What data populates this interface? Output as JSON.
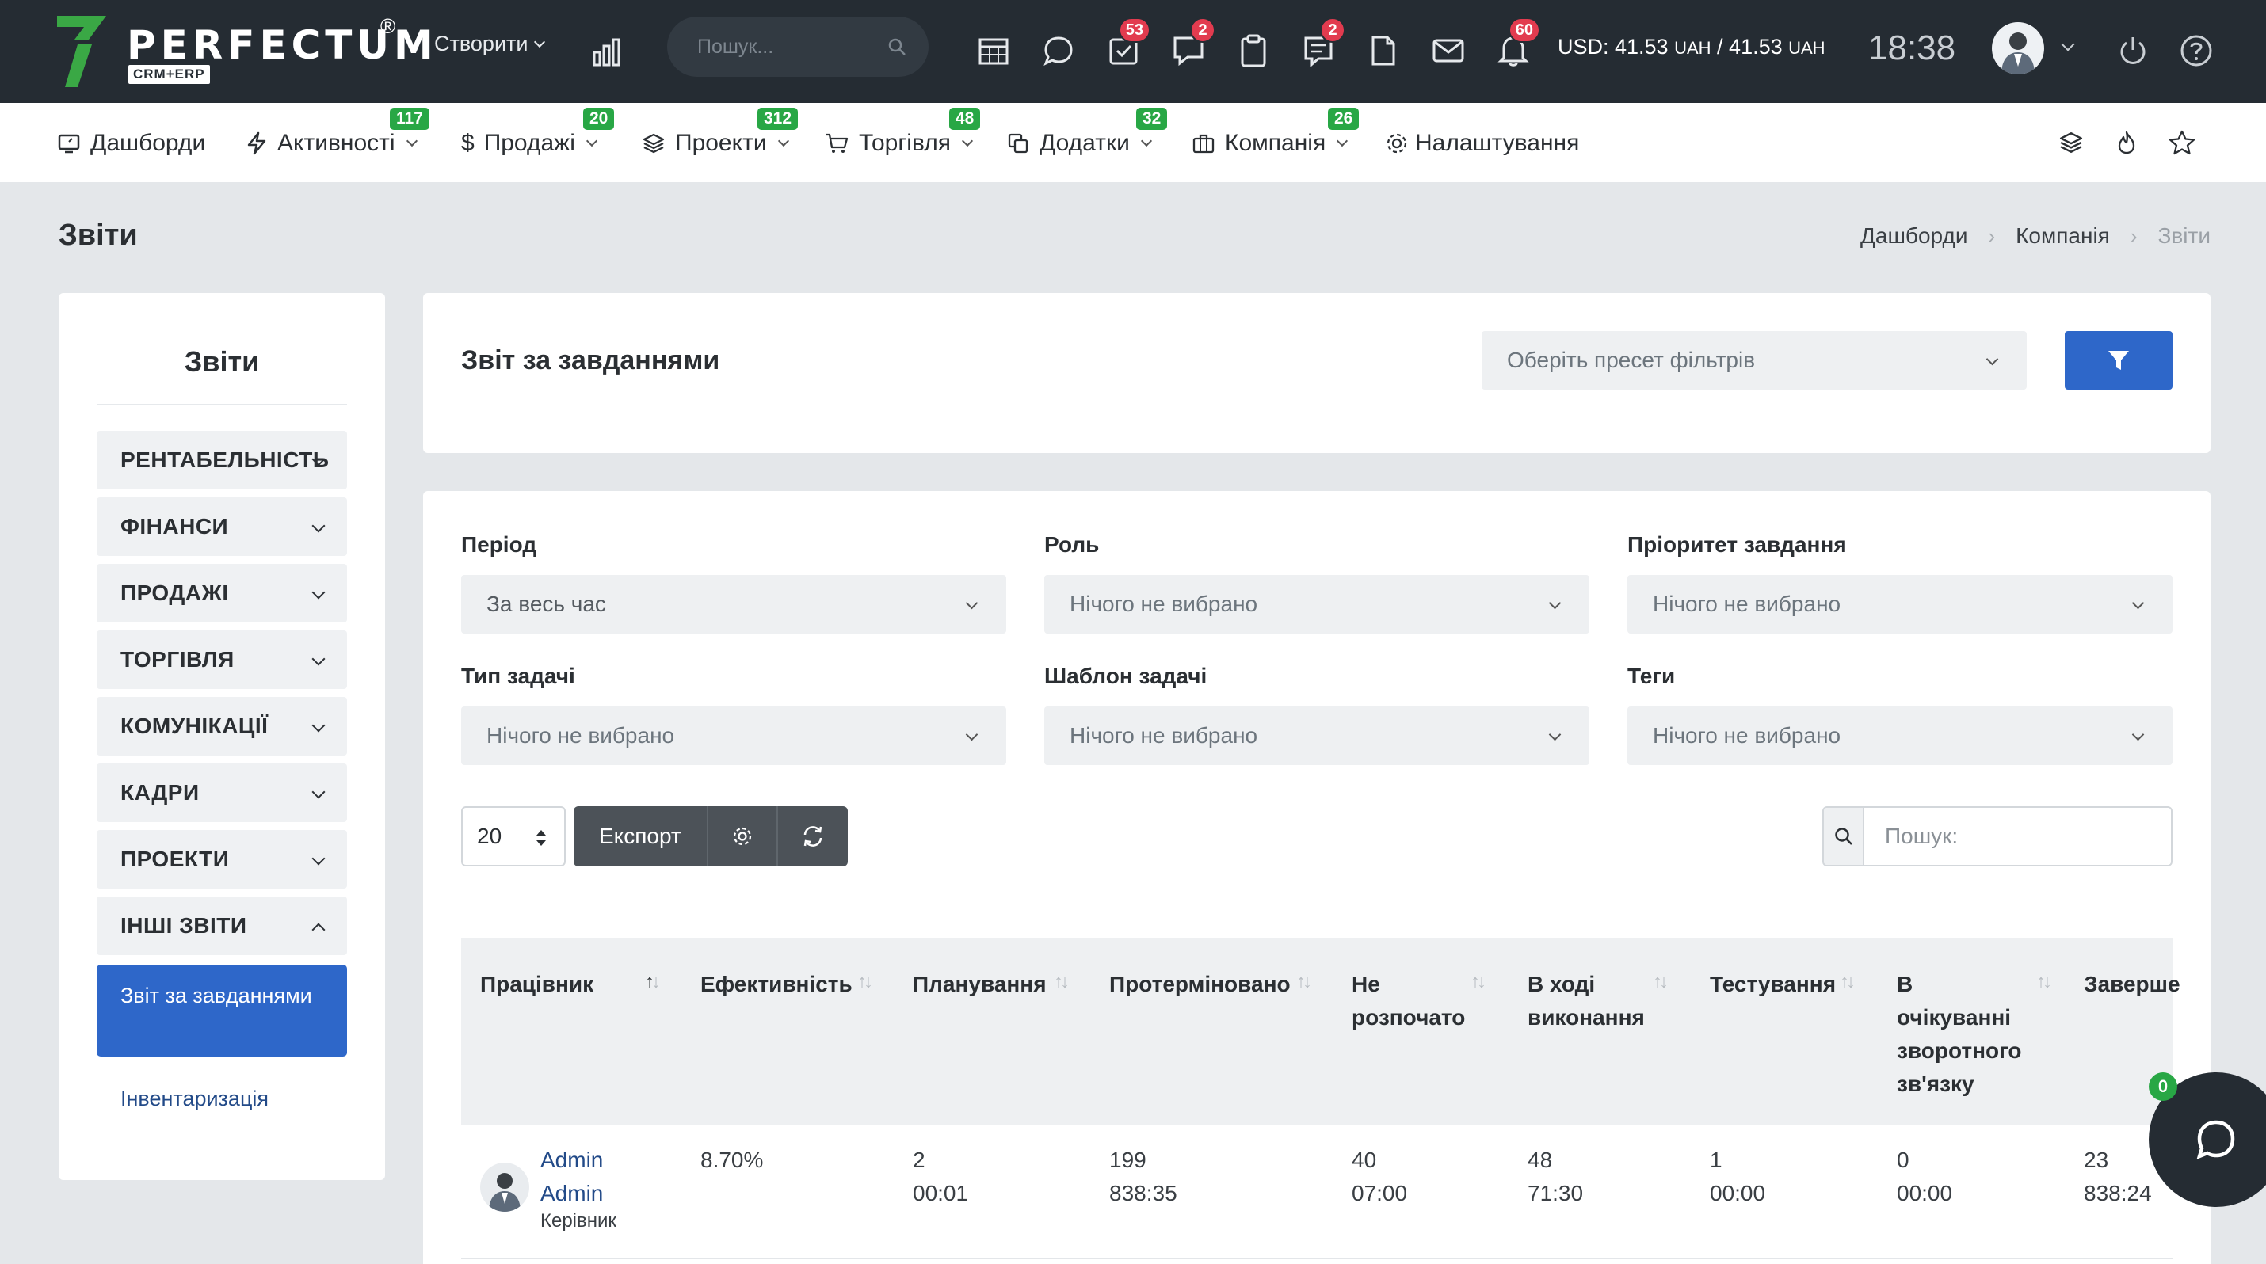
{
  "app": {
    "logo_text": "PERFECTUM",
    "logo_reg": "®",
    "logo_sub": "CRM+ERP"
  },
  "topbar": {
    "create_label": "Створити",
    "search_placeholder": "Пошук...",
    "icons": [
      {
        "name": "calendar-icon",
        "badge": ""
      },
      {
        "name": "chat-icon",
        "badge": ""
      },
      {
        "name": "tasks-icon",
        "badge": "53"
      },
      {
        "name": "comments-icon",
        "badge": "2"
      },
      {
        "name": "clipboard-icon",
        "badge": ""
      },
      {
        "name": "notes-icon",
        "badge": "2"
      },
      {
        "name": "document-icon",
        "badge": ""
      },
      {
        "name": "mail-icon",
        "badge": ""
      },
      {
        "name": "bell-icon",
        "badge": "60"
      }
    ],
    "currency_prefix": "USD: 41.53",
    "currency_unit1": "UAH",
    "currency_mid": " / 41.53 ",
    "currency_unit2": "UAH",
    "time": "18:38"
  },
  "mainnav": {
    "items": [
      {
        "label": "Дашборди",
        "badge": "",
        "icon": "monitor-icon",
        "chevron": false
      },
      {
        "label": "Активності",
        "badge": "117",
        "icon": "bolt-icon",
        "chevron": true
      },
      {
        "label": "Продажі",
        "badge": "20",
        "icon": "dollar-icon",
        "chevron": true
      },
      {
        "label": "Проекти",
        "badge": "312",
        "icon": "layers-icon",
        "chevron": true
      },
      {
        "label": "Торгівля",
        "badge": "48",
        "icon": "cart-icon",
        "chevron": true
      },
      {
        "label": "Додатки",
        "badge": "32",
        "icon": "copy-icon",
        "chevron": true
      },
      {
        "label": "Компанія",
        "badge": "26",
        "icon": "briefcase-icon",
        "chevron": true
      },
      {
        "label": "Налаштування",
        "badge": "",
        "icon": "gear-icon",
        "chevron": false
      }
    ]
  },
  "page": {
    "title": "Звіти",
    "breadcrumb": [
      "Дашборди",
      "Компанія",
      "Звіти"
    ]
  },
  "sidebar": {
    "title": "Звіти",
    "categories": [
      {
        "label": "РЕНТАБЕЛЬНІСТЬ",
        "expanded": false
      },
      {
        "label": "ФІНАНСИ",
        "expanded": false
      },
      {
        "label": "ПРОДАЖІ",
        "expanded": false
      },
      {
        "label": "ТОРГІВЛЯ",
        "expanded": false
      },
      {
        "label": "КОМУНІКАЦІЇ",
        "expanded": false
      },
      {
        "label": "КАДРИ",
        "expanded": false
      },
      {
        "label": "ПРОЕКТИ",
        "expanded": false
      },
      {
        "label": "ІНШІ ЗВІТИ",
        "expanded": true
      }
    ],
    "active_sub": "Звіт за завданнями",
    "other_sub": "Інвентаризація"
  },
  "report": {
    "title": "Звіт за завданнями",
    "preset_placeholder": "Оберіть пресет фільтрів",
    "filters": [
      {
        "label": "Період",
        "value": "За весь час"
      },
      {
        "label": "Роль",
        "value": "Нічого не вибрано"
      },
      {
        "label": "Пріоритет завдання",
        "value": "Нічого не вибрано"
      },
      {
        "label": "Тип задачі",
        "value": "Нічого не вибрано"
      },
      {
        "label": "Шаблон задачі",
        "value": "Нічого не вибрано"
      },
      {
        "label": "Теги",
        "value": "Нічого не вибрано"
      }
    ],
    "page_size": "20",
    "export_label": "Експорт",
    "search_placeholder": "Пошук:",
    "columns": [
      {
        "label": "Працівник"
      },
      {
        "label": "Ефективність"
      },
      {
        "label": "Планування"
      },
      {
        "label": "Протерміновано"
      },
      {
        "label": "Не розпочато"
      },
      {
        "label": "В ході виконання"
      },
      {
        "label": "Тестування"
      },
      {
        "label": "В очікуванні зворотного зв'язку"
      },
      {
        "label": "Заверше"
      }
    ],
    "rows": [
      {
        "employee_first": "Admin",
        "employee_last": "Admin",
        "role": "Керівник",
        "efficiency": "8.70%",
        "planning": [
          "2",
          "00:01"
        ],
        "overdue": [
          "199",
          "838:35"
        ],
        "not_started": [
          "40",
          "07:00"
        ],
        "in_progress": [
          "48",
          "71:30"
        ],
        "testing": [
          "1",
          "00:00"
        ],
        "awaiting": [
          "0",
          "00:00"
        ],
        "completed": [
          "23",
          "838:24"
        ]
      }
    ]
  },
  "chat": {
    "badge": "0"
  },
  "colors": {
    "topbar": "#252c33",
    "accent": "#2e67c9",
    "badge_red": "#e23b4f",
    "badge_green": "#28a745",
    "logo_green": "#3aa845"
  }
}
